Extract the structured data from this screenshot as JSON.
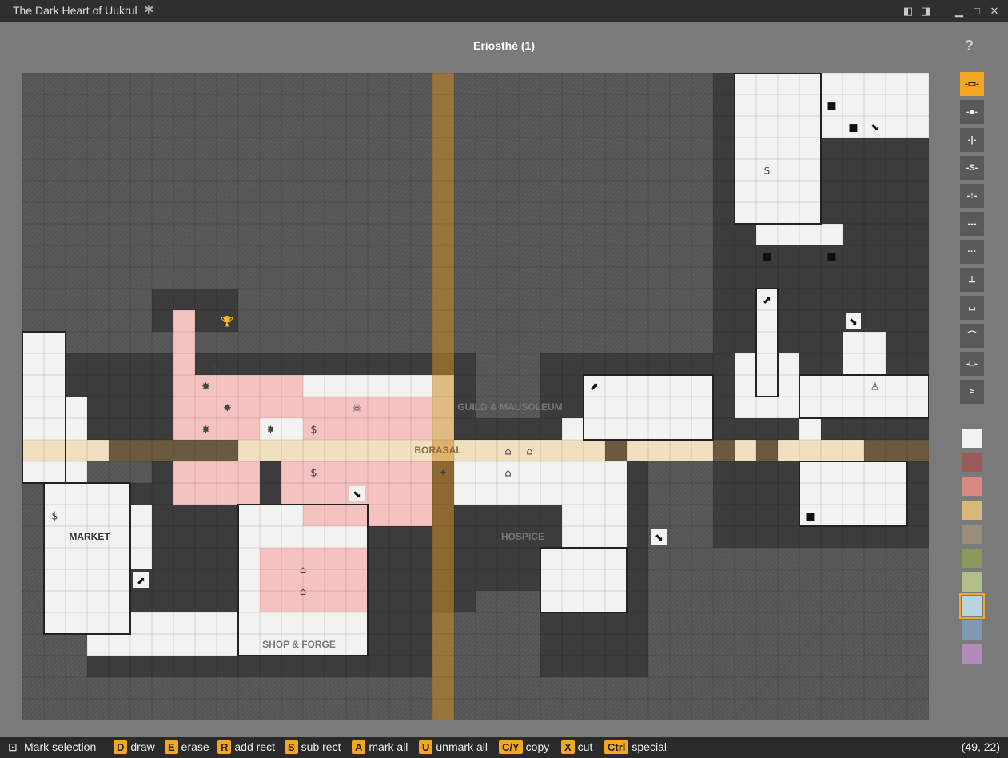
{
  "window": {
    "title": "The Dark Heart of Uukrul"
  },
  "map": {
    "title": "Eriosthé (1)"
  },
  "help_label": "?",
  "labels": [
    "GUILD & MAUSOLEUM",
    "BORASAL",
    "MARKET",
    "HOSPICE",
    "SHOP & FORGE"
  ],
  "tools": [
    {
      "name": "tool-door",
      "glyph": "-▭-"
    },
    {
      "name": "tool-locked-door",
      "glyph": "-■-"
    },
    {
      "name": "tool-gate",
      "glyph": "-|-"
    },
    {
      "name": "tool-secret-door",
      "glyph": "-S-"
    },
    {
      "name": "tool-oneway-door",
      "glyph": "-↑-"
    },
    {
      "name": "tool-wall",
      "glyph": "---"
    },
    {
      "name": "tool-invisible-wall",
      "glyph": "···"
    },
    {
      "name": "tool-lever",
      "glyph": "⊥"
    },
    {
      "name": "tool-pit",
      "glyph": "⌴"
    },
    {
      "name": "tool-arch",
      "glyph": "⌒"
    },
    {
      "name": "tool-button",
      "glyph": "-□-"
    },
    {
      "name": "tool-water",
      "glyph": "≈"
    }
  ],
  "colors": [
    "#f2f2f0",
    "#9a5a5a",
    "#d98a80",
    "#d8b878",
    "#9a8e78",
    "#8a9a5a",
    "#b4c08a",
    "#b8d4de",
    "#7e9ab0",
    "#b08ab8"
  ],
  "selected_color": 7,
  "status": {
    "mode": "Mark selection",
    "shortcuts": [
      {
        "key": "D",
        "label": "draw"
      },
      {
        "key": "E",
        "label": "erase"
      },
      {
        "key": "R",
        "label": "add rect"
      },
      {
        "key": "S",
        "label": "sub rect"
      },
      {
        "key": "A",
        "label": "mark all"
      },
      {
        "key": "U",
        "label": "unmark all"
      },
      {
        "key": "C/Y",
        "label": "copy"
      },
      {
        "key": "X",
        "label": "cut"
      },
      {
        "key": "Ctrl",
        "label": "special"
      }
    ],
    "coords": "(49, 22)"
  }
}
